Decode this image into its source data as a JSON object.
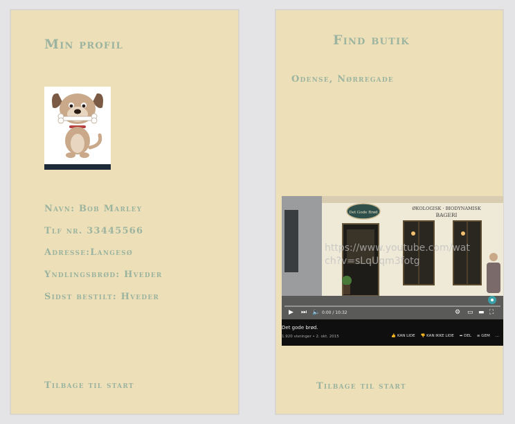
{
  "profile": {
    "title": "Min profil",
    "name": "Navn: Bob Marley",
    "phone": "Tlf nr. 33445566",
    "address": "Adresse:Langesø",
    "favorite_bread": "Yndlingsbrød: Hveder",
    "last_order": "Sidst bestilt: Hveder",
    "back_link": "Tilbage til start",
    "avatar_icon": "dog-cartoon-icon"
  },
  "shop": {
    "title": "Find butik",
    "location": "Odense, Nørregade",
    "back_link": "Tilbage til start",
    "video": {
      "url_overlay": "https://www.youtube.com/watch?v=sLqUqm3fotg",
      "shop_sign": "Det Gode Brød",
      "facade_line1": "ØKOLOGISK · BIODYNAMISK",
      "facade_line2": "BAGERI",
      "time": "0:00 / 10:32",
      "title": "Det gode brød.",
      "meta": "1.920 visninger • 2. okt. 2015",
      "actions": [
        "KAN LIDE",
        "KAN IKKE LIDE",
        "DEL",
        "GEM",
        "..."
      ]
    }
  },
  "colors": {
    "panel_bg": "#ede0b8",
    "accent_text": "#9cb3a0",
    "page_bg": "#e4e4e6"
  }
}
